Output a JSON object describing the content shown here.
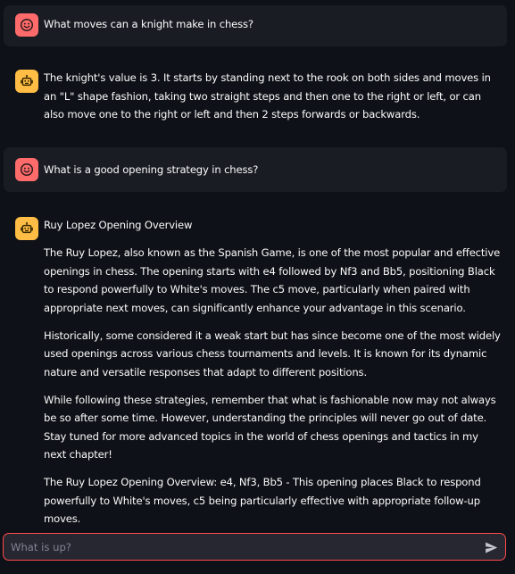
{
  "conversation": [
    {
      "role": "user",
      "avatar_icon": "smiley-face-icon",
      "paragraphs": [
        "What moves can a knight make in chess?"
      ]
    },
    {
      "role": "assistant",
      "avatar_icon": "robot-icon",
      "paragraphs": [
        "The knight's value is 3. It starts by standing next to the rook on both sides and moves in an \"L\" shape fashion, taking two straight steps and then one to the right or left, or can also move one to the right or left and then 2 steps forwards or backwards."
      ]
    },
    {
      "role": "user",
      "avatar_icon": "smiley-face-icon",
      "paragraphs": [
        "What is a good opening strategy in chess?"
      ]
    },
    {
      "role": "assistant",
      "avatar_icon": "robot-icon",
      "paragraphs": [
        "Ruy Lopez Opening Overview",
        "The Ruy Lopez, also known as the Spanish Game, is one of the most popular and effective openings in chess. The opening starts with e4 followed by Nf3 and Bb5, positioning Black to respond powerfully to White's moves. The c5 move, particularly when paired with appropriate next moves, can significantly enhance your advantage in this scenario.",
        "Historically, some considered it a weak start but has since become one of the most widely used openings across various chess tournaments and levels. It is known for its dynamic nature and versatile responses that adapt to different positions.",
        "While following these strategies, remember that what is fashionable now may not always be so after some time. However, understanding the principles will never go out of date. Stay tuned for more advanced topics in the world of chess openings and tactics in my next chapter!",
        "The Ruy Lopez Opening Overview: e4, Nf3, Bb5 - This opening places Black to respond powerfully to White's moves, c5 being particularly effective with appropriate follow-up moves."
      ]
    }
  ],
  "chat_input": {
    "placeholder": "What is up?",
    "value": "",
    "send_icon": "send-arrow-icon"
  },
  "colors": {
    "background": "#0e1117",
    "user_message_bg": "#1a1c24",
    "user_avatar": "#ff6b6b",
    "assistant_avatar": "#ffbd45",
    "input_border": "#ff4b4b",
    "input_bg": "#262730",
    "text": "#fafafa",
    "placeholder": "#808495"
  }
}
